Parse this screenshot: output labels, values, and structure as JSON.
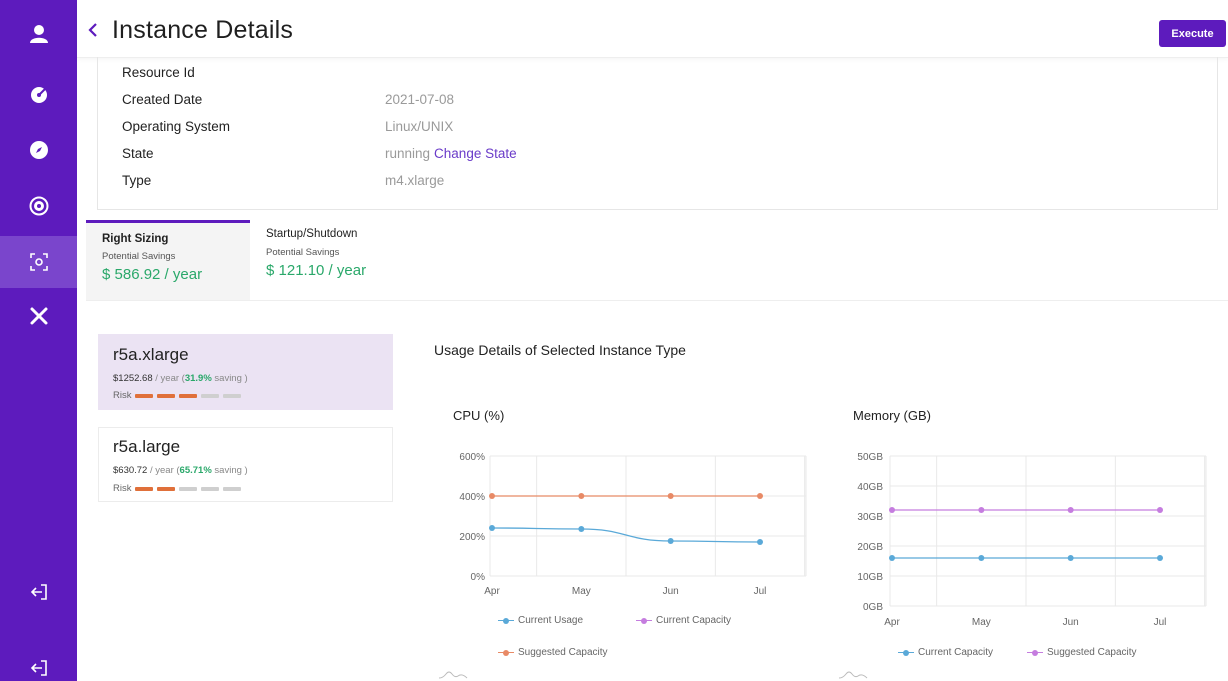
{
  "header": {
    "title": "Instance Details",
    "execute_label": "Execute"
  },
  "sidebar": {
    "items": [
      {
        "name": "user-icon"
      },
      {
        "name": "dashboard-gauge-icon"
      },
      {
        "name": "compass-icon"
      },
      {
        "name": "savings-coin-icon"
      },
      {
        "name": "instance-scan-icon",
        "active": true
      },
      {
        "name": "tools-icon"
      },
      {
        "name": "logout-icon"
      },
      {
        "name": "logout-icon"
      }
    ]
  },
  "details": {
    "rows": [
      {
        "label": "Resource Id",
        "value": ""
      },
      {
        "label": "Created Date",
        "value": "2021-07-08"
      },
      {
        "label": "Operating System",
        "value": "Linux/UNIX"
      },
      {
        "label": "State",
        "value": "running",
        "link": "Change State"
      },
      {
        "label": "Type",
        "value": "m4.xlarge"
      }
    ]
  },
  "tabs": [
    {
      "title": "Right Sizing",
      "subtitle": "Potential Savings",
      "amount": "$ 586.92 / year",
      "active": true
    },
    {
      "title": "Startup/Shutdown",
      "subtitle": "Potential Savings",
      "amount": "$ 121.10 / year",
      "active": false
    }
  ],
  "instances": [
    {
      "name": "r5a.xlarge",
      "price": "$1252.68",
      "per": " / year (",
      "pct": "31.9%",
      "suffix": " saving )",
      "risk_label": "Risk",
      "risk_level": 3,
      "selected": true
    },
    {
      "name": "r5a.large",
      "price": "$630.72",
      "per": " / year (",
      "pct": "65.71%",
      "suffix": " saving )",
      "risk_label": "Risk",
      "risk_level": 2,
      "selected": false
    }
  ],
  "colors": {
    "accent": "#5d1bbd",
    "risk_on": "#e0703a",
    "risk_off": "#cfcfcf",
    "saving_green": "#2aa86a",
    "blue": "#5aa9d8",
    "orange": "#e88a66",
    "purple": "#c57ddf"
  },
  "usage_title": "Usage Details of Selected Instance Type",
  "chart_data": [
    {
      "type": "line",
      "title": "CPU (%)",
      "categories": [
        "Apr",
        "May",
        "Jun",
        "Jul"
      ],
      "ylim": [
        0,
        600
      ],
      "yticks": [
        "0%",
        "200%",
        "400%",
        "600%"
      ],
      "ytick_values": [
        0,
        200,
        400,
        600
      ],
      "grid": true,
      "series": [
        {
          "name": "Current Usage",
          "values": [
            240,
            235,
            175,
            170
          ],
          "color": "#5aa9d8",
          "smooth": true
        },
        {
          "name": "Current Capacity",
          "values": [
            null,
            null,
            null,
            null
          ],
          "color": "#c57ddf"
        },
        {
          "name": "Suggested Capacity",
          "values": [
            400,
            400,
            400,
            400
          ],
          "color": "#e88a66"
        }
      ]
    },
    {
      "type": "line",
      "title": "Memory (GB)",
      "categories": [
        "Apr",
        "May",
        "Jun",
        "Jul"
      ],
      "ylim": [
        0,
        50
      ],
      "yticks": [
        "0GB",
        "10GB",
        "20GB",
        "30GB",
        "40GB",
        "50GB"
      ],
      "ytick_values": [
        0,
        10,
        20,
        30,
        40,
        50
      ],
      "grid": true,
      "series": [
        {
          "name": "Current Capacity",
          "values": [
            16,
            16,
            16,
            16
          ],
          "color": "#5aa9d8"
        },
        {
          "name": "Suggested Capacity",
          "values": [
            32,
            32,
            32,
            32
          ],
          "color": "#c57ddf"
        }
      ]
    }
  ]
}
